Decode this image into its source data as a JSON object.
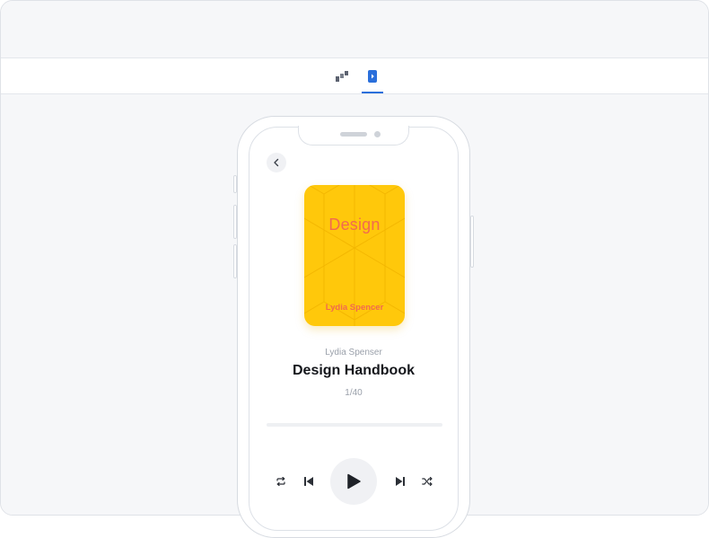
{
  "toolbar": {
    "tools": [
      {
        "icon": "stairs-chart-icon",
        "active": false
      },
      {
        "icon": "preview-play-icon",
        "active": true
      }
    ],
    "accent": "#2a6fdb"
  },
  "book": {
    "cover_title": "Design",
    "cover_author": "Lydia Spencer",
    "cover_color": "#ffc80b",
    "cover_text_color": "#f26a4f",
    "author": "Lydia Spenser",
    "title": "Design Handbook",
    "page": "1/40"
  },
  "player": {
    "progress": 0,
    "controls": [
      "repeat-icon",
      "previous-icon",
      "play-icon",
      "next-icon",
      "shuffle-icon"
    ]
  }
}
